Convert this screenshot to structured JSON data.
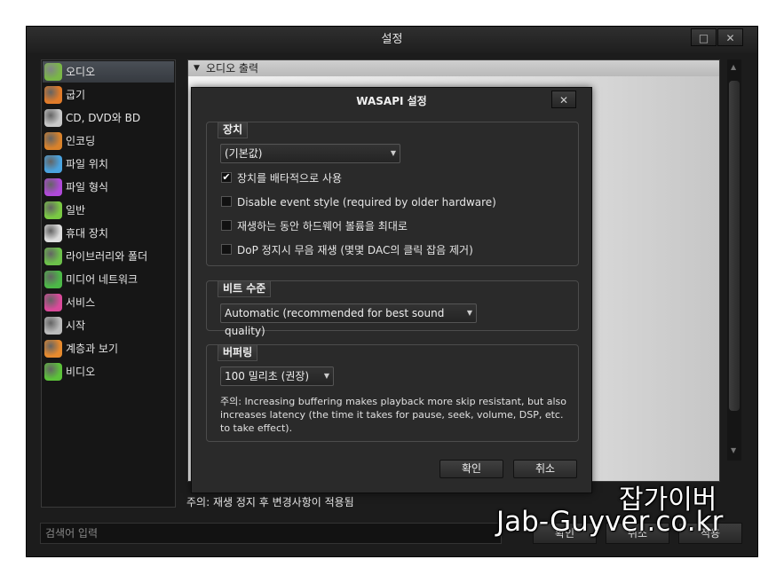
{
  "window": {
    "title": "설정",
    "maximize_glyph": "□",
    "close_glyph": "✕"
  },
  "sidebar": {
    "items": [
      {
        "label": "오디오",
        "icon": "audio-icon",
        "color": "#7ab648",
        "selected": true
      },
      {
        "label": "굽기",
        "icon": "burn-icon",
        "color": "#e07b2a"
      },
      {
        "label": "CD, DVD와 BD",
        "icon": "disc-icon",
        "color": "#c8c8c8"
      },
      {
        "label": "인코딩",
        "icon": "encoding-icon",
        "color": "#d9822b"
      },
      {
        "label": "파일 위치",
        "icon": "file-location-icon",
        "color": "#4aa3df"
      },
      {
        "label": "파일 형식",
        "icon": "file-format-icon",
        "color": "#b04ad9"
      },
      {
        "label": "일반",
        "icon": "general-icon",
        "color": "#7ac943"
      },
      {
        "label": "휴대 장치",
        "icon": "portable-device-icon",
        "color": "#dddddd"
      },
      {
        "label": "라이브러리와 폴더",
        "icon": "library-icon",
        "color": "#6cc04a"
      },
      {
        "label": "미디어 네트워크",
        "icon": "media-network-icon",
        "color": "#4cb847"
      },
      {
        "label": "서비스",
        "icon": "services-icon",
        "color": "#d94a9a"
      },
      {
        "label": "시작",
        "icon": "startup-icon",
        "color": "#bbbbbb"
      },
      {
        "label": "계층과 보기",
        "icon": "hierarchy-icon",
        "color": "#e68a2e"
      },
      {
        "label": "비디오",
        "icon": "video-icon",
        "color": "#5cc13a"
      }
    ]
  },
  "main": {
    "section_header": "오디오 출력",
    "note": "주의: 재생 정지 후 변경사항이 적용됨"
  },
  "bottom": {
    "search_placeholder": "검색어 입력",
    "ok_label": "확인",
    "cancel_label": "취소",
    "apply_label": "적용"
  },
  "dialog": {
    "title": "WASAPI 설정",
    "close_glyph": "✕",
    "device_group": {
      "title": "장치",
      "device_value": "(기본값)",
      "checkboxes": [
        {
          "label": "장치를 배타적으로 사용",
          "checked": true
        },
        {
          "label": "Disable event style (required by older hardware)",
          "checked": false
        },
        {
          "label": "재생하는 동안 하드웨어 볼륨을 최대로",
          "checked": false
        },
        {
          "label": "DoP 정지시 무음 재생 (몇몇 DAC의 클릭 잡음 제거)",
          "checked": false
        }
      ]
    },
    "bitdepth_group": {
      "title": "비트 수준",
      "value": "Automatic (recommended for best sound quality)"
    },
    "buffer_group": {
      "title": "버퍼링",
      "value": "100 밀리초 (권장)",
      "note": "주의: Increasing buffering makes playback more skip resistant, but also increases latency (the time it takes for pause, seek, volume, DSP, etc. to take effect)."
    },
    "ok_label": "확인",
    "cancel_label": "취소"
  },
  "watermark": {
    "line1": "잡가이버",
    "line2": "Jab-Guyver.co.kr"
  }
}
